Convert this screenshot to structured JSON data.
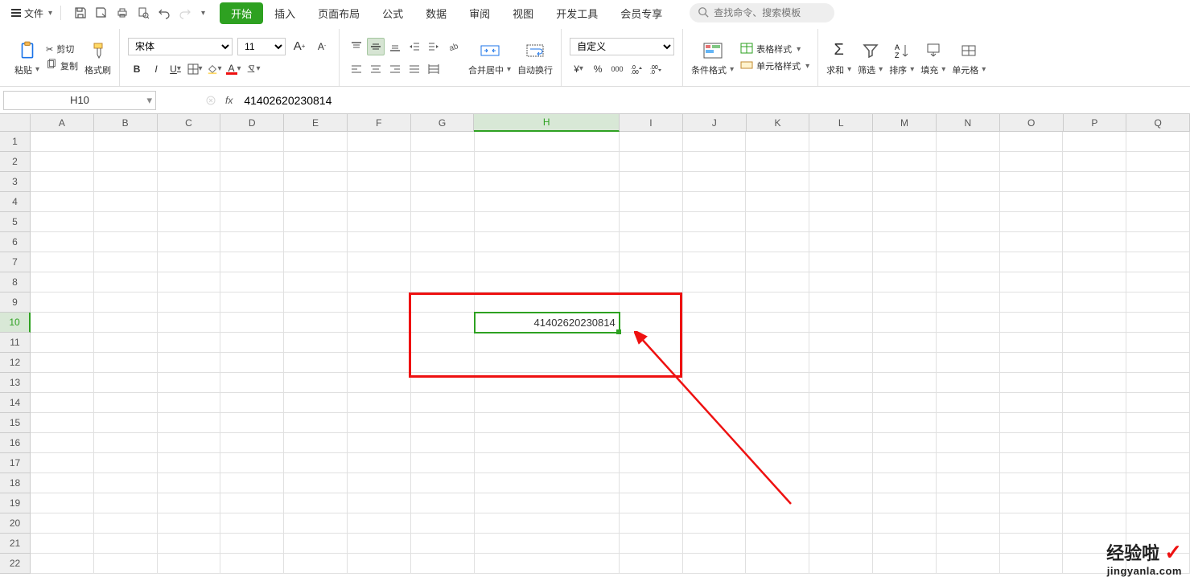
{
  "menu": {
    "file": "文件",
    "tabs": {
      "start": "开始",
      "insert": "插入",
      "pagelayout": "页面布局",
      "formula": "公式",
      "data": "数据",
      "review": "审阅",
      "view": "视图",
      "dev": "开发工具",
      "member": "会员专享"
    },
    "search_placeholder": "查找命令、搜索模板"
  },
  "ribbon": {
    "paste": "粘贴",
    "cut": "剪切",
    "copy": "复制",
    "format_painter": "格式刷",
    "font_name": "宋体",
    "font_size": "11",
    "merge_center": "合并居中",
    "wrap_text": "自动换行",
    "number_format": "自定义",
    "cond_format": "条件格式",
    "table_style": "表格样式",
    "cell_style": "单元格样式",
    "sum": "求和",
    "filter": "筛选",
    "sort": "排序",
    "fill": "填充",
    "cells": "单元格"
  },
  "formula_bar": {
    "cell_ref": "H10",
    "fx": "fx",
    "formula": "41402620230814"
  },
  "grid": {
    "columns": [
      "A",
      "B",
      "C",
      "D",
      "E",
      "F",
      "G",
      "H",
      "I",
      "J",
      "K",
      "L",
      "M",
      "N",
      "O",
      "P",
      "Q"
    ],
    "wide_col": "H",
    "active_col": "H",
    "rows": 22,
    "active_row": 10,
    "cell_value": "41402620230814",
    "cell_row": 10,
    "cell_col": "H"
  },
  "watermark": {
    "line1": "经验啦",
    "line2": "jingyanla.com"
  }
}
